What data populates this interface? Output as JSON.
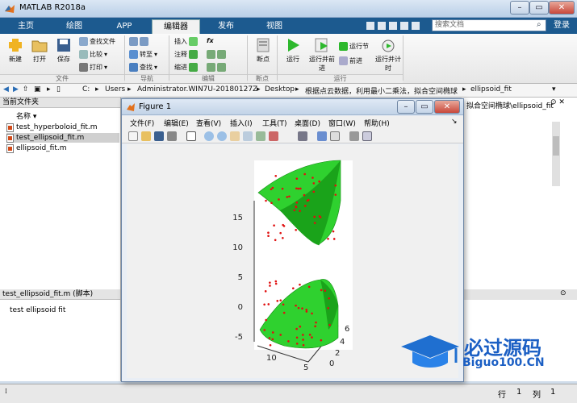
{
  "window": {
    "title": "MATLAB R2018a"
  },
  "tabs": [
    {
      "label": "主页"
    },
    {
      "label": "绘图"
    },
    {
      "label": "APP"
    },
    {
      "label": "编辑器"
    },
    {
      "label": "发布"
    },
    {
      "label": "视图"
    }
  ],
  "search": {
    "placeholder": "搜索文档"
  },
  "login_label": "登录",
  "toolstrip": {
    "file": {
      "label": "文件",
      "new": "新建",
      "open": "打开",
      "save": "保存",
      "find_files": "查找文件",
      "compare": "比较",
      "print": "打印"
    },
    "nav": {
      "label": "导航",
      "goto": "转至",
      "find": "查找"
    },
    "edit": {
      "label": "编辑",
      "insert": "插入",
      "comment": "注释",
      "indent": "缩进",
      "fx": "fx"
    },
    "breakpoint": {
      "label": "断点",
      "breakpoint": "断点"
    },
    "run": {
      "label": "运行",
      "run": "运行",
      "run_advance": "运行并前进",
      "run_section": "运行节",
      "advance": "前进",
      "run_time": "运行并计时"
    }
  },
  "address": {
    "parts": [
      "C:",
      "Users",
      "Administrator.WIN7U-20180127Z",
      "Desktop",
      "根据点云数据，利用最小二乘法，拟合空间椭球",
      "ellipsoid_fit"
    ]
  },
  "current_folder": {
    "header": "当前文件夹",
    "name_col": "名称",
    "files": [
      "test_hyperboloid_fit.m",
      "test_ellipsoid_fit.m",
      "ellipsoid_fit.m"
    ],
    "selected": "test_ellipsoid_fit.m"
  },
  "details": {
    "header": "test_ellipsoid_fit.m  (脚本)",
    "content": "test ellipsoid fit"
  },
  "right_pane": {
    "path": "拟合空间椭球\\ellipsoid_fit"
  },
  "status": {
    "row_label": "行",
    "row": "1",
    "col_label": "列",
    "col": "1"
  },
  "figure": {
    "title": "Figure 1",
    "menu": [
      "文件(F)",
      "编辑(E)",
      "查看(V)",
      "插入(I)",
      "工具(T)",
      "桌面(D)",
      "窗口(W)",
      "帮助(H)"
    ],
    "z_ticks": [
      "15",
      "10",
      "5",
      "0",
      "-5"
    ],
    "x_ticks": [
      "10",
      "5"
    ],
    "y_ticks": [
      "6",
      "4",
      "2",
      "0"
    ]
  },
  "watermark": {
    "line1": "必过源码",
    "line2": "Biguo100.CN"
  },
  "colors": {
    "ribbon_blue": "#1c5a8f",
    "surface_green": "#2fd12f",
    "points_red": "#e01010"
  }
}
